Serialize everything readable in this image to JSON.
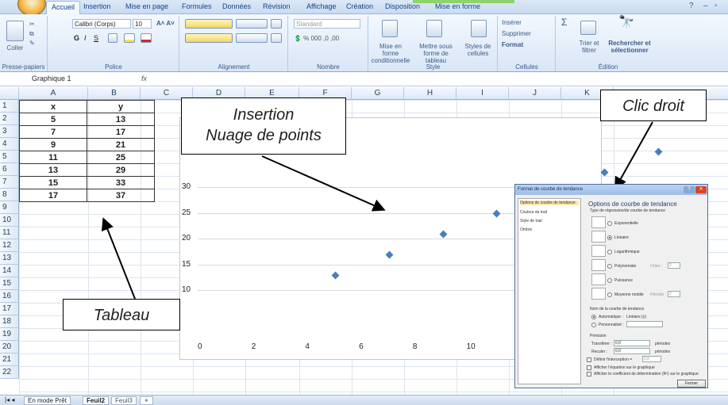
{
  "ribbon_tabs": [
    "Accueil",
    "Insertion",
    "Mise en page",
    "Formules",
    "Données",
    "Révision",
    "Affichage",
    "Création",
    "Disposition",
    "Mise en forme"
  ],
  "ribbon": {
    "clipboard": {
      "paste": "Coller",
      "label": "Presse-papiers"
    },
    "font": {
      "name": "Calibri (Corps)",
      "size": "10",
      "label": "Police"
    },
    "alignment": {
      "label": "Alignement"
    },
    "number": {
      "format": "Standard",
      "label": "Nombre"
    },
    "style": {
      "cond_format": "Mise en forme conditionnelle",
      "table_format": "Mettre sous forme de tableau",
      "cell_styles": "Styles de cellules",
      "label": "Style"
    },
    "cells": {
      "insert": "Insérer",
      "delete": "Supprimer",
      "format": "Format",
      "label": "Cellules"
    },
    "edition": {
      "sort": "Trier et filtrer",
      "find": "Rechercher et sélectionner",
      "label": "Édition"
    }
  },
  "formula_bar": {
    "name_box": "Graphique 1",
    "fx": "fx"
  },
  "columns": [
    "A",
    "B",
    "C",
    "D",
    "E",
    "F",
    "G",
    "H",
    "I",
    "J",
    "K"
  ],
  "rows": [
    "1",
    "2",
    "3",
    "4",
    "5",
    "6",
    "7",
    "8",
    "9",
    "10",
    "11",
    "12",
    "13",
    "14",
    "15",
    "16",
    "17",
    "18",
    "19",
    "20",
    "21",
    "22"
  ],
  "table": {
    "headers": [
      "x",
      "y"
    ],
    "rows": [
      [
        "5",
        "13"
      ],
      [
        "7",
        "17"
      ],
      [
        "9",
        "21"
      ],
      [
        "11",
        "25"
      ],
      [
        "13",
        "29"
      ],
      [
        "15",
        "33"
      ],
      [
        "17",
        "37"
      ]
    ]
  },
  "chart_data": {
    "type": "scatter",
    "x": [
      5,
      7,
      9,
      11,
      13,
      15,
      17
    ],
    "y": [
      13,
      17,
      21,
      25,
      29,
      33,
      37
    ],
    "xlim": [
      0,
      14
    ],
    "ylim": [
      0,
      30
    ],
    "xticks": [
      "0",
      "2",
      "4",
      "6",
      "8",
      "10",
      "12",
      "14"
    ],
    "yticks": [
      "10",
      "15",
      "20",
      "25",
      "30"
    ],
    "point_color": "#4a7ebb",
    "grid": "horizontal"
  },
  "callouts": {
    "insertion": [
      "Insertion",
      "Nuage de points"
    ],
    "clic_droit": "Clic droit",
    "tableau": "Tableau"
  },
  "dialog": {
    "title": "Format de courbe de tendance",
    "nav": [
      "Options de courbe de tendance",
      "Couleur du trait",
      "Style de trait",
      "Ombre"
    ],
    "heading": "Options de courbe de tendance",
    "type_label": "Type de régression/de courbe de tendance",
    "types": [
      "Exponentielle",
      "Linéaire",
      "Logarithmique",
      "Polynomiale",
      "Puissance",
      "Moyenne mobile"
    ],
    "ordre_label": "Ordre :",
    "ordre_value": "2",
    "periode_label": "Période :",
    "periode_value": "2",
    "name_label": "Nom de la courbe de tendance",
    "auto_label": "Automatique :",
    "auto_value": "Linéaire (y)",
    "custom_label": "Personnalisé :",
    "forecast_label": "Prévision",
    "forward_label": "Transférer :",
    "forward_value": "0,0",
    "backward_label": "Reculer :",
    "backward_value": "0,0",
    "periods": "périodes",
    "intercept_label": "Définir l'interception =",
    "intercept_value": "0,0",
    "show_eq": "Afficher l'équation sur le graphique",
    "show_r2": "Afficher le coefficient de détermination (R²) sur le graphique",
    "close": "Fermer"
  },
  "sheets": {
    "status": "En mode Prêt",
    "tabs": [
      "Feuil2",
      "Feuil3"
    ]
  }
}
